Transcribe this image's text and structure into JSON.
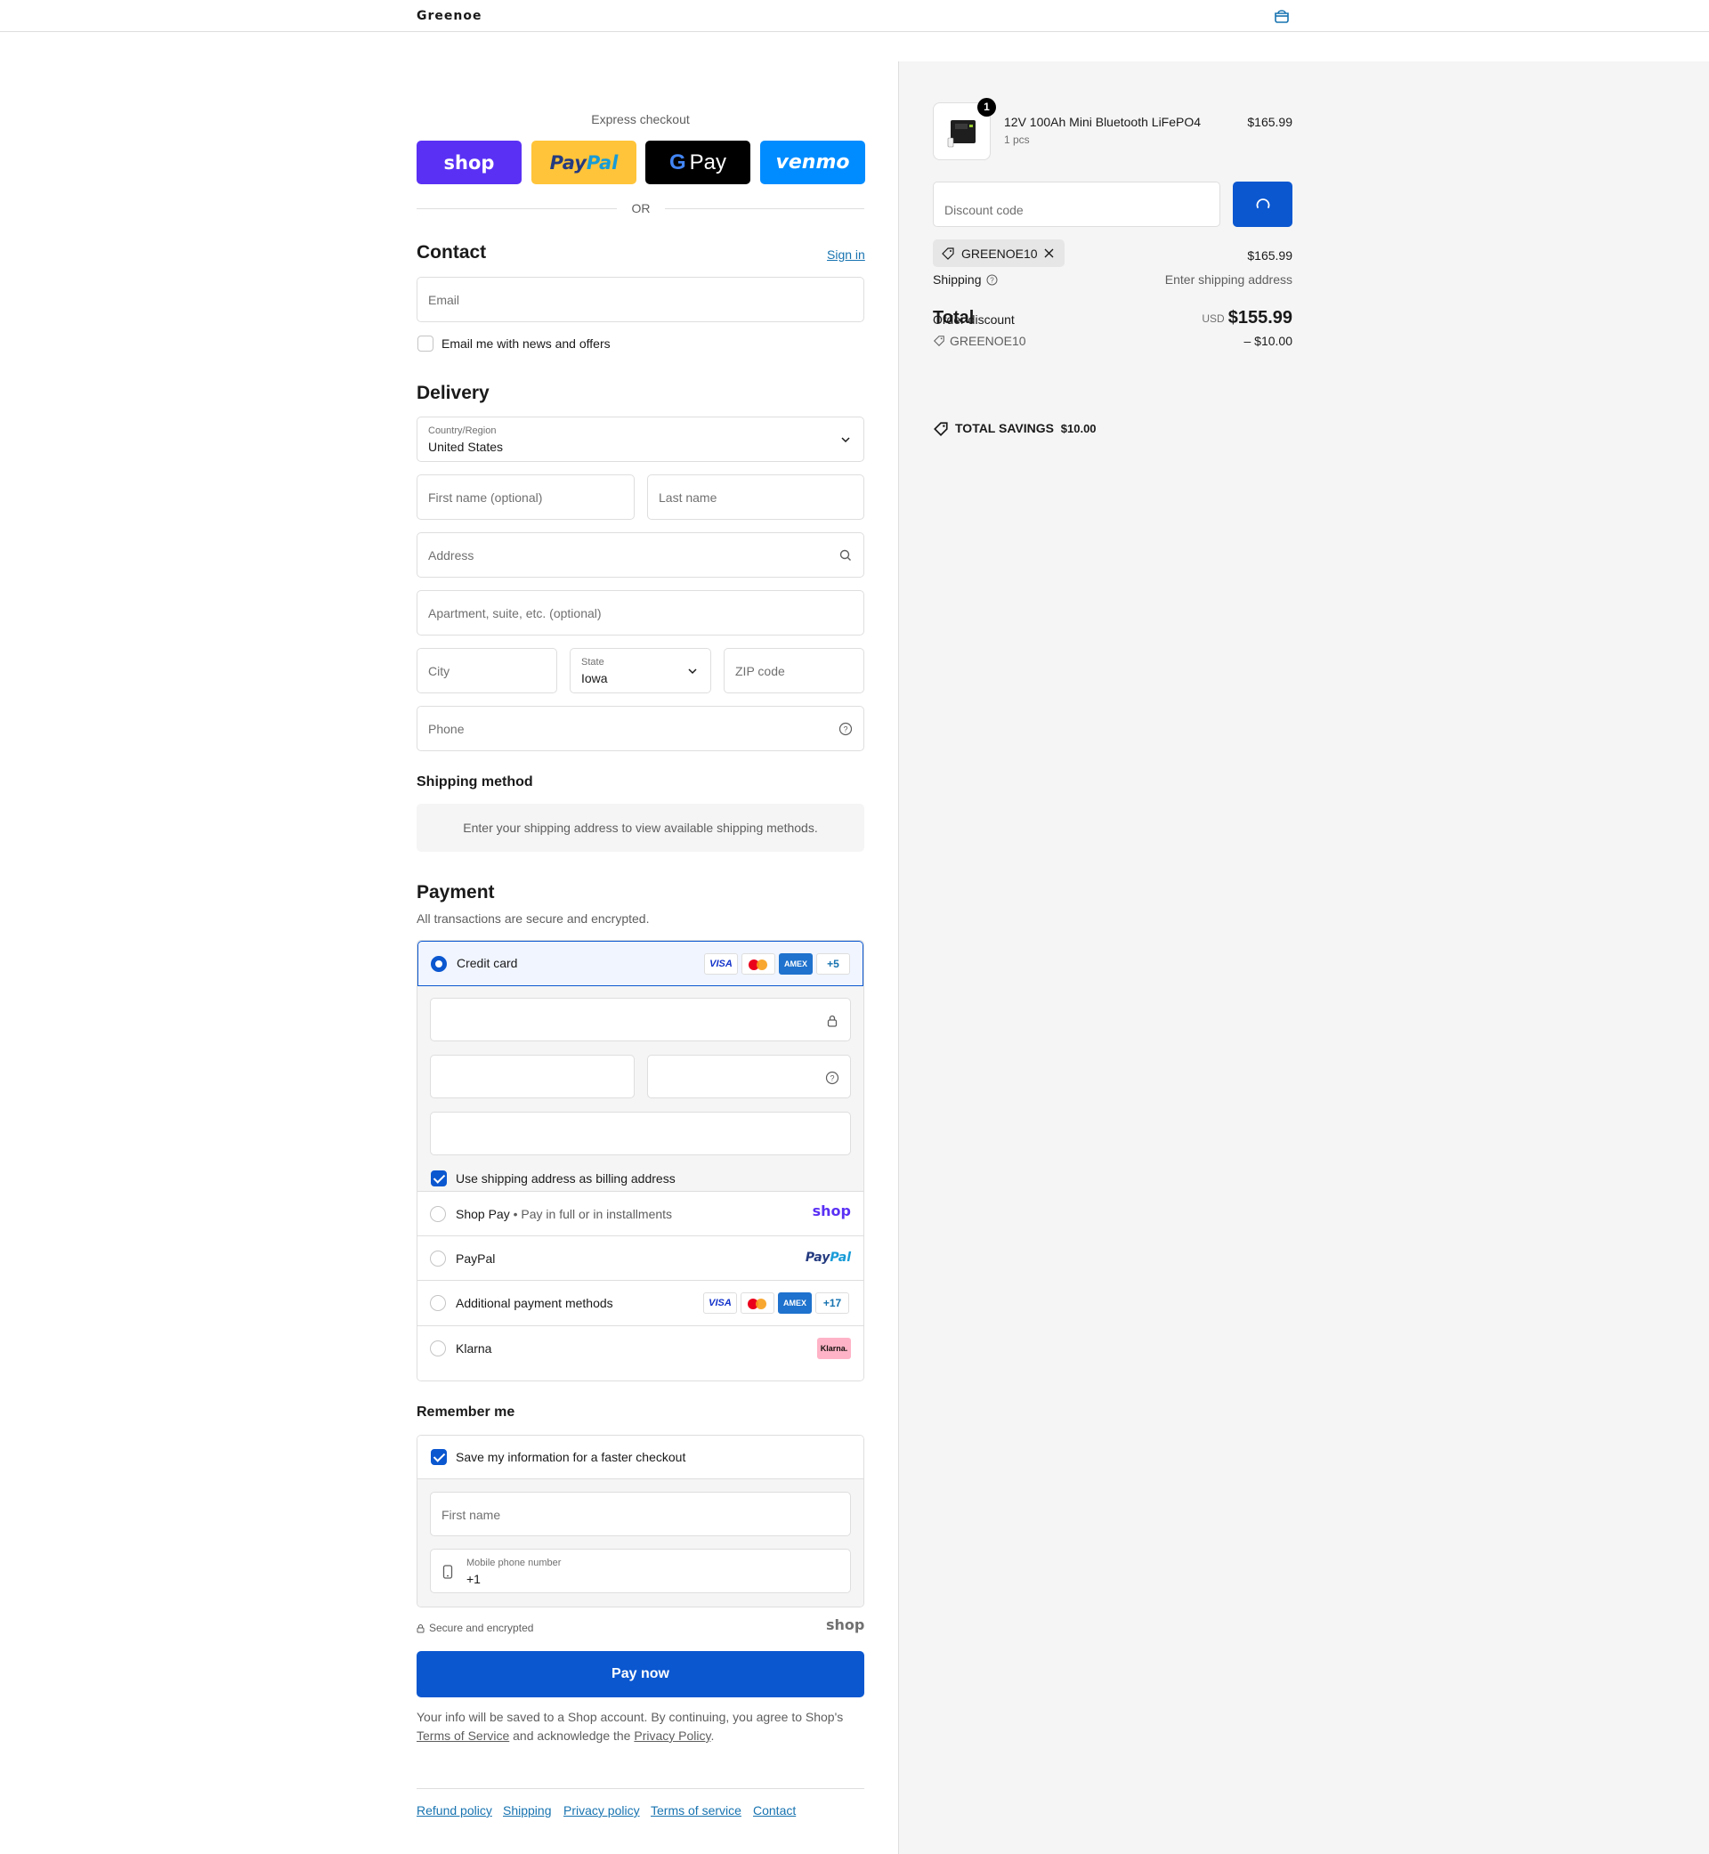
{
  "header": {
    "logo": "Greenoe"
  },
  "express": {
    "label": "Express checkout",
    "shop": "shop",
    "paypal_a": "Pay",
    "paypal_b": "Pal",
    "gpay_g": "G",
    "gpay": "Pay",
    "venmo": "venmo",
    "or": "OR"
  },
  "contact": {
    "title": "Contact",
    "sign_in": "Sign in",
    "email_placeholder": "Email",
    "news_label": "Email me with news and offers"
  },
  "delivery": {
    "title": "Delivery",
    "country_label": "Country/Region",
    "country_value": "United States",
    "first_name": "First name (optional)",
    "last_name": "Last name",
    "address": "Address",
    "apartment": "Apartment, suite, etc. (optional)",
    "city": "City",
    "state_label": "State",
    "state_value": "Iowa",
    "zip": "ZIP code",
    "phone": "Phone"
  },
  "shipping_method": {
    "title": "Shipping method",
    "message": "Enter your shipping address to view available shipping methods."
  },
  "payment": {
    "title": "Payment",
    "subtitle": "All transactions are secure and encrypted.",
    "credit_card": "Credit card",
    "visa": "VISA",
    "amex": "AMEX",
    "cc_more": "+5",
    "billing_same": "Use shipping address as billing address",
    "shop_pay": "Shop Pay",
    "shop_pay_sub": "Pay in full or in installments",
    "shop_pay_logo": "shop",
    "paypal": "PayPal",
    "paypal_logo_a": "Pay",
    "paypal_logo_b": "Pal",
    "additional": "Additional payment methods",
    "additional_more": "+17",
    "klarna": "Klarna",
    "klarna_logo": "Klarna."
  },
  "remember": {
    "title": "Remember me",
    "save_label": "Save my information for a faster checkout",
    "first_name": "First name",
    "mobile_label": "Mobile phone number",
    "mobile_value": "+1",
    "secure": "Secure and encrypted",
    "shop_logo": "shop"
  },
  "pay_now": "Pay now",
  "legal": {
    "text1": "Your info will be saved to a Shop account. By continuing, you agree to Shop's ",
    "tos": "Terms of Service",
    "text2": " and acknowledge the ",
    "privacy": "Privacy Policy",
    "text3": "."
  },
  "footer": {
    "links": [
      "Refund policy",
      "Shipping",
      "Privacy policy",
      "Terms of service",
      "Contact"
    ]
  },
  "summary": {
    "product_name": "12V 100Ah Mini Bluetooth LiFePO4",
    "product_variant": "1 pcs",
    "product_price": "$165.99",
    "quantity": "1",
    "discount_placeholder": "Discount code",
    "applied_code": "GREENOE10",
    "subtotal_value": "$165.99",
    "shipping_label": "Shipping",
    "shipping_value": "Enter shipping address",
    "total_label": "Total",
    "order_discount_label": "Order discount",
    "currency": "USD",
    "total_value": "$155.99",
    "discount_code": "GREENOE10",
    "discount_value": "– $10.00",
    "savings_label": "TOTAL SAVINGS",
    "savings_value": "$10.00"
  },
  "colors": {
    "primary": "#0b57d0",
    "shop_purple": "#5a31f4",
    "paypal_yellow": "#ffc439",
    "venmo_blue": "#008cff",
    "link": "#1773b0"
  }
}
